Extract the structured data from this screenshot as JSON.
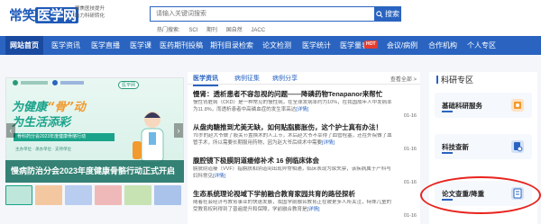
{
  "header": {
    "logo_text_plain": "常笑",
    "logo_text_boxed": "医学网",
    "slogan_lines": [
      "聚焦医技提升",
      "助力科研转化"
    ],
    "search": {
      "placeholder": "请输入关键词搜索",
      "button_label": "搜索"
    },
    "hot_search": {
      "label": "热门搜索:",
      "terms": [
        "SCI",
        "期刊",
        "国自然",
        "JACC"
      ]
    }
  },
  "nav": {
    "items": [
      {
        "label": "网站首页",
        "active": true
      },
      {
        "label": "医学资讯"
      },
      {
        "label": "医学直播"
      },
      {
        "label": "医学课"
      },
      {
        "label": "医药期刊投稿"
      },
      {
        "label": "期刊目录检索"
      },
      {
        "label": "论文检测"
      },
      {
        "label": "医学统计"
      },
      {
        "label": "医学量表",
        "badge": "HOT"
      },
      {
        "label": "会议/病例"
      },
      {
        "label": "合作机构"
      },
      {
        "label": "个人专区"
      }
    ]
  },
  "banner": {
    "badge": "医学网",
    "title_part1": "为健康",
    "title_highlight": "“骨”动",
    "title_part2": "为生活添彩",
    "subtitle": "骨科药分会2023年度健康骨骼行动",
    "small_text": "主办单位 · 承办单位 · 支持单位",
    "caption": "慢病防治分会2023年度健康骨骼行动正式开启"
  },
  "news": {
    "tabs": [
      "医学资讯",
      "病例征集",
      "病例分享"
    ],
    "more_label": "查看全部 >",
    "detail_label": "[详情]",
    "items": [
      {
        "title": "慢肾：透析患者不容忽视的问题——降磷药物Tenapanor来帮忙",
        "desc": "慢性肾脏病（CKD）是一种常见的慢性病，在全球发病率约为10%，在我国成年人中发病率为11.8%，而透析患者中高磷血症的发生率高达",
        "date": "01-16"
      },
      {
        "title": "从盘肉糖推到尤美无缺，如何贴脂膨胀伤，这个护士真有办法！",
        "desc": "70岁的赵大爷做了股关节置换术的人工节，术后赵大爷不幸得了血管栓塞，还在外院做了血管手术，所以需要长期服用药物，因为赵大爷后续术中需要",
        "date": "01-16"
      },
      {
        "title": "腹腔镜下极膜阴道瘘修补术 16 例临床体会",
        "desc": "膀胱阴道瘘（VVF）指膀胱和阴道间出现异常相通，临床表现为尿失禁，该疾病属于产科与妇科常见",
        "date": "01-16"
      },
      {
        "title": "生态系统理论视域下学前融合教育家园共育的路径探析",
        "desc": "随着社会经济与教育事业的快速发展，我国学前融合教育正在被更多人所关注，特殊儿童的受教育权利得到了普遍提升和保障，学前融合教育是",
        "date": "01-16"
      }
    ]
  },
  "sidebar": {
    "title": "科研专区",
    "cards": [
      {
        "label": "基础科研服务",
        "icon": "research-icon",
        "color": "#f29a2e"
      },
      {
        "label": "科技查新",
        "icon": "novelty-search-icon",
        "color": "#2a64c0"
      },
      {
        "label": "论文查重/降重",
        "icon": "paper-check-icon",
        "color": "#e8231d"
      }
    ]
  },
  "colors": {
    "primary": "#2a64c0",
    "nav_active": "#1a4aa0",
    "hot_badge": "#e63b2e",
    "annotation_red": "#e8231d",
    "banner_green": "#1aa38a",
    "banner_orange": "#f29a2e"
  }
}
